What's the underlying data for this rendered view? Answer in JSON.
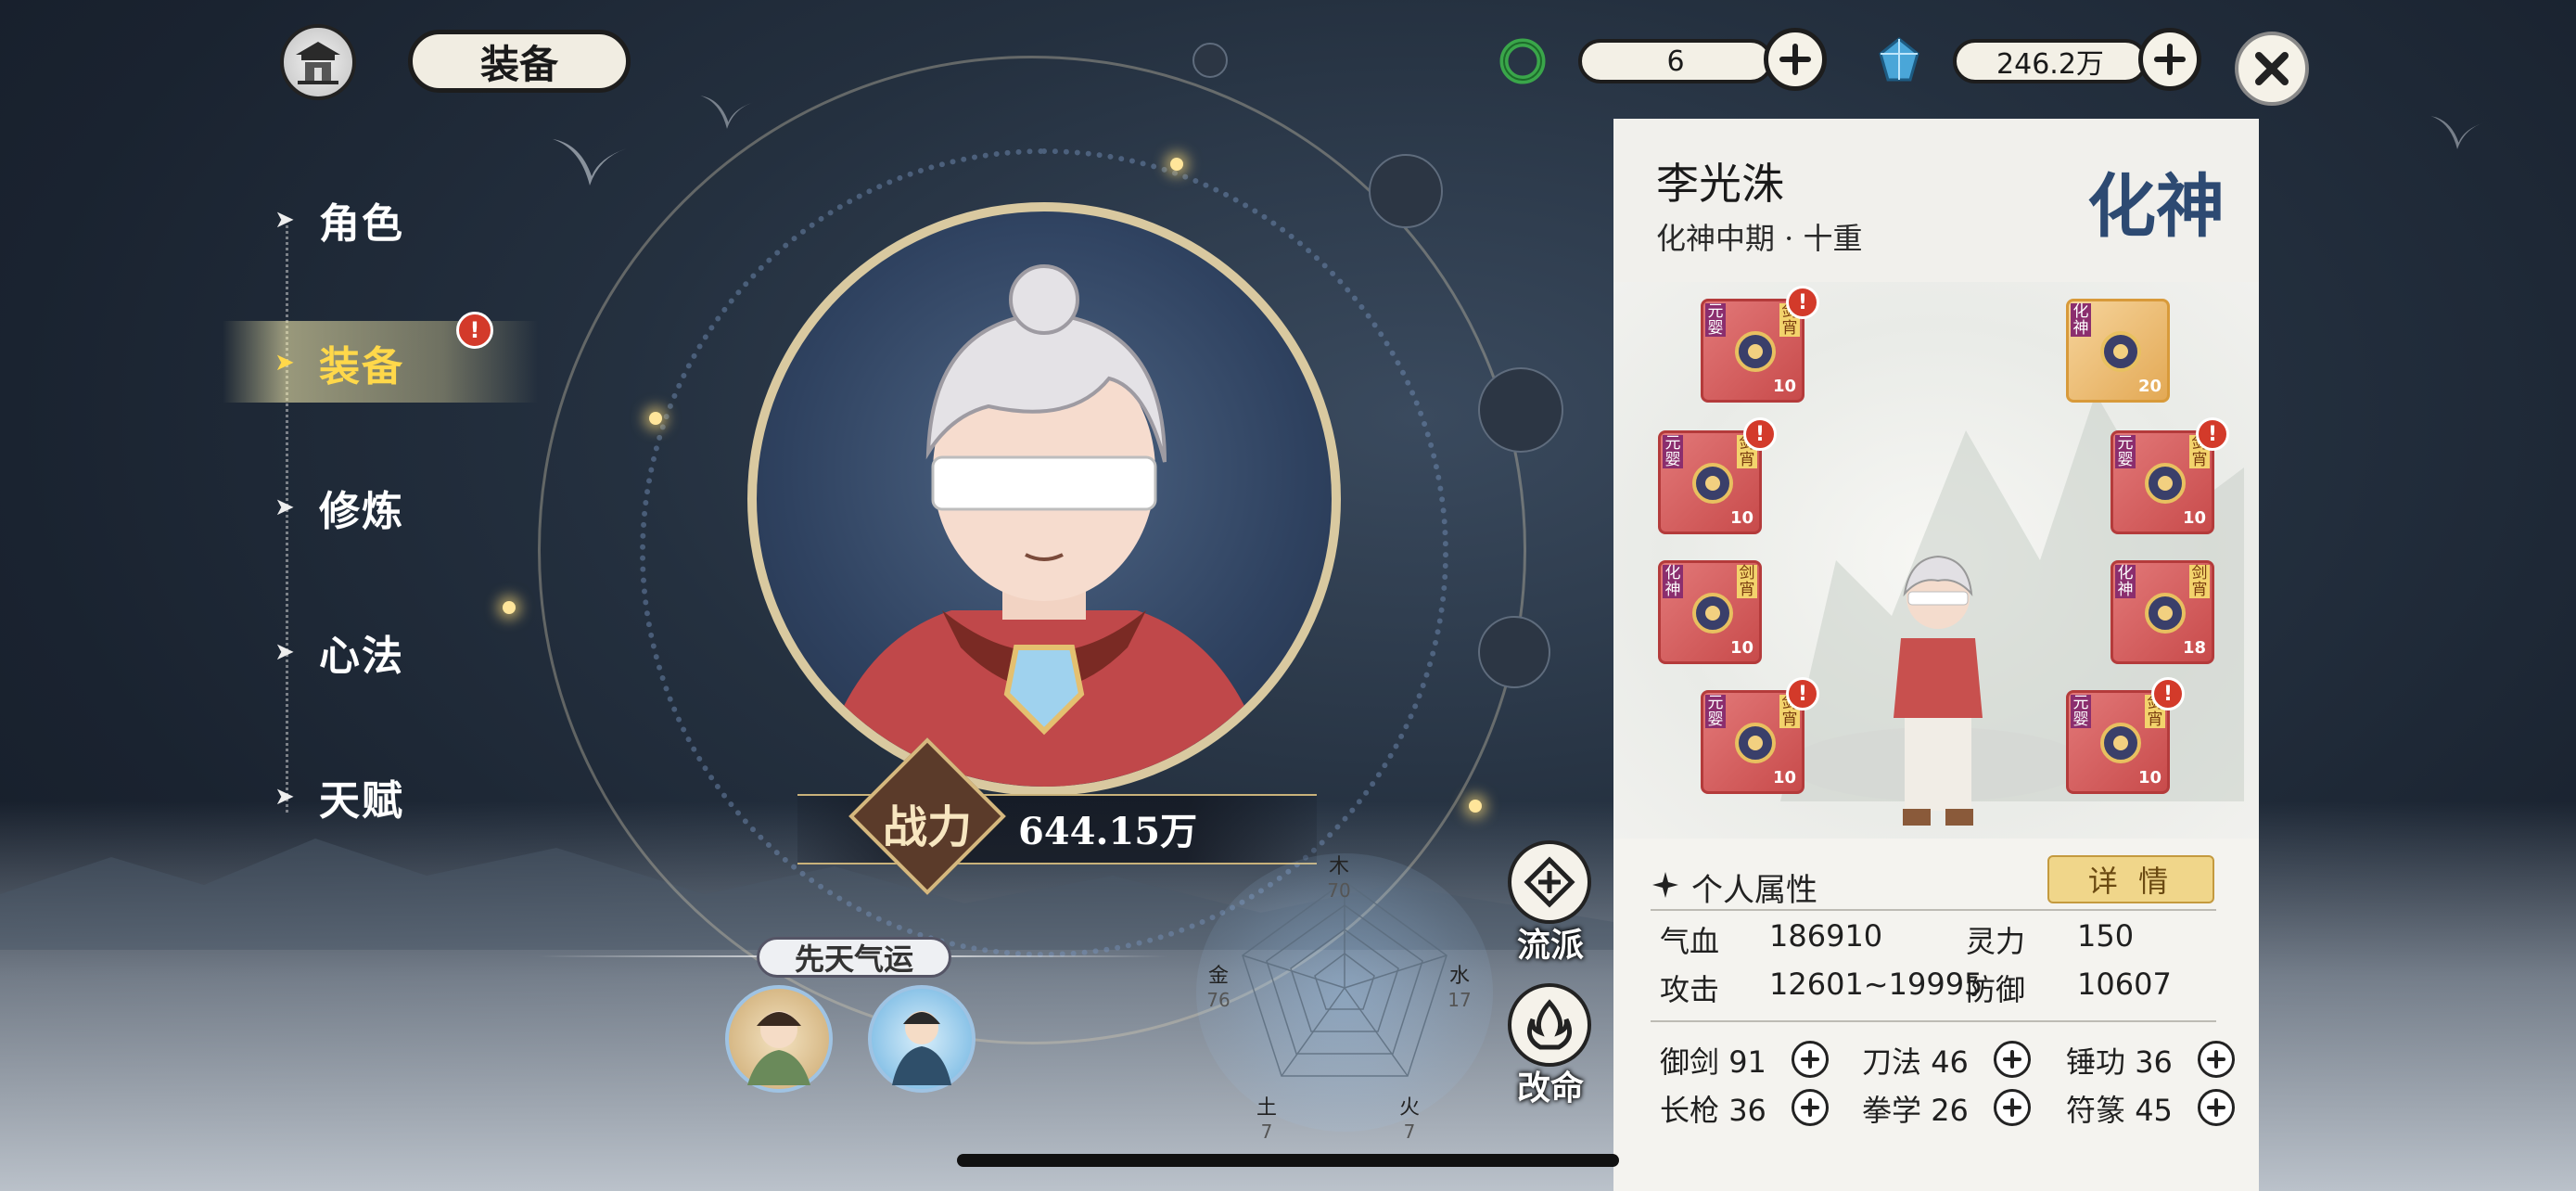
{
  "header": {
    "title": "装备",
    "resource1": {
      "icon": "jade-ring-icon",
      "value": "6"
    },
    "resource2": {
      "icon": "blue-crystal-icon",
      "value": "246.2万"
    }
  },
  "nav": {
    "items": [
      {
        "label": "角色",
        "active": false
      },
      {
        "label": "装备",
        "active": true,
        "badge": "!"
      },
      {
        "label": "修炼",
        "active": false
      },
      {
        "label": "心法",
        "active": false
      },
      {
        "label": "天赋",
        "active": false
      }
    ]
  },
  "power": {
    "label": "战力",
    "value": "644.15万"
  },
  "fortune": {
    "title": "先天气运"
  },
  "radar": {
    "elements": [
      {
        "name": "木",
        "value": "70"
      },
      {
        "name": "水",
        "value": "17"
      },
      {
        "name": "火",
        "value": "7"
      },
      {
        "name": "土",
        "value": "7"
      },
      {
        "name": "金",
        "value": "76"
      }
    ]
  },
  "side_buttons": {
    "school": "流派",
    "fate": "改命"
  },
  "character": {
    "name": "李光洙",
    "realm": "化神中期 · 十重",
    "realm_seal": "化神"
  },
  "equipment": [
    {
      "rank": "元婴",
      "tag": "剑宵",
      "level": "10",
      "badge": true,
      "quality": "red"
    },
    {
      "rank": "化神",
      "tag": "",
      "level": "20",
      "badge": false,
      "quality": "gold"
    },
    {
      "rank": "元婴",
      "tag": "剑宵",
      "level": "10",
      "badge": true,
      "quality": "red"
    },
    {
      "rank": "元婴",
      "tag": "剑宵",
      "level": "10",
      "badge": true,
      "quality": "red"
    },
    {
      "rank": "化神",
      "tag": "剑宵",
      "level": "10",
      "badge": false,
      "quality": "red"
    },
    {
      "rank": "化神",
      "tag": "剑宵",
      "level": "18",
      "badge": false,
      "quality": "red"
    },
    {
      "rank": "元婴",
      "tag": "剑宵",
      "level": "10",
      "badge": true,
      "quality": "red"
    },
    {
      "rank": "元婴",
      "tag": "剑宵",
      "level": "10",
      "badge": true,
      "quality": "red"
    }
  ],
  "stats": {
    "header": "个人属性",
    "detail_button": "详 情",
    "qixue_label": "气血",
    "qixue_value": "186910",
    "lingli_label": "灵力",
    "lingli_value": "150",
    "gongji_label": "攻击",
    "gongji_value": "12601~19995",
    "fangyu_label": "防御",
    "fangyu_value": "10607"
  },
  "skills": [
    {
      "name": "御剑",
      "value": "91"
    },
    {
      "name": "刀法",
      "value": "46"
    },
    {
      "name": "锤功",
      "value": "36"
    },
    {
      "name": "长枪",
      "value": "36"
    },
    {
      "name": "拳学",
      "value": "26"
    },
    {
      "name": "符篆",
      "value": "45"
    }
  ],
  "colors": {
    "accent_gold": "#ffd84a",
    "badge_red": "#d33a2a",
    "panel_bg": "#f4f3ef"
  }
}
